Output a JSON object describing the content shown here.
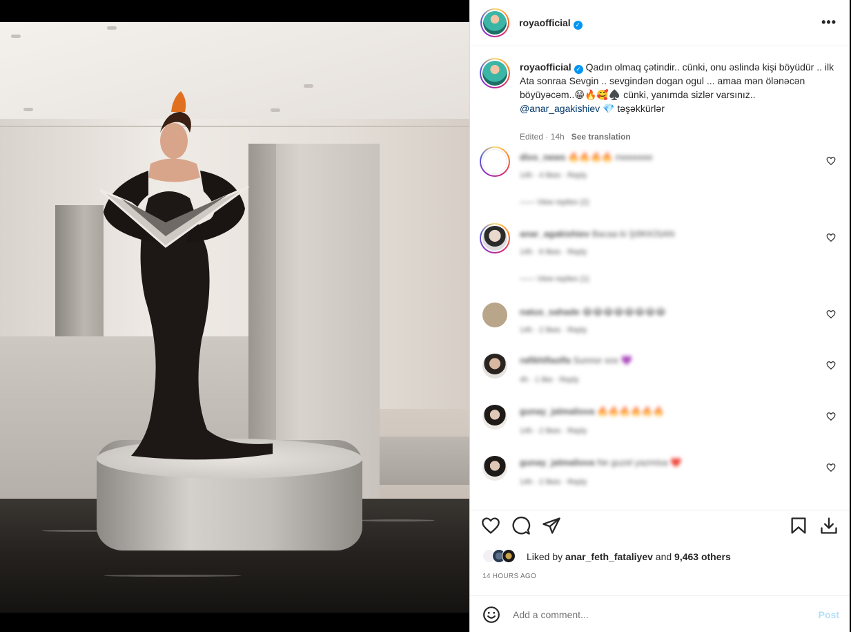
{
  "post": {
    "username": "royaofficial",
    "verified_mark": "✓",
    "more_icon": "•••",
    "caption": {
      "username": "royaofficial",
      "text_part1": "Qadın olmaq çətindir.. cünki, onu əslində kişi böyüdür .. ilk Ata sonraa Sevgin .. sevgindən dogan ogul ... amaa mən ölənəcən böyüyəcəm..😁🔥🥰♠️ cünki, yanımda sizlər varsınız.. ",
      "mention": "@anar_agakishiev",
      "text_part2": " 💎 təşəkkürlər",
      "edited": "Edited · 14h",
      "see_translation": "See translation"
    },
    "comments": [
      {
        "username": "divo_news",
        "text": "🔥🔥🔥🔥 meeeeee",
        "meta": "14h · 4 likes · Reply",
        "replies": "View replies (2)",
        "avatar_color": "#ffffff"
      },
      {
        "username": "anar_agakishiev",
        "text": "Bacaa ki ŞƏKKİSAN",
        "meta": "14h · 6 likes · Reply",
        "replies": "View replies (1)",
        "avatar_color": "#d9d9d9"
      },
      {
        "username": "natus_sahade",
        "text": "😂😂😂😂😂😂😂😂",
        "meta": "14h · 2 likes · Reply",
        "replies": "",
        "avatar_color": "#b9a68a"
      },
      {
        "username": "rafikhlfaolfa",
        "text": "Sunnor xox 💜",
        "meta": "4h · 1 like · Reply",
        "replies": "",
        "avatar_color": "#8a7b70"
      },
      {
        "username": "gunay_jalmaliova",
        "text": "🔥🔥🔥🔥🔥🔥",
        "meta": "14h · 2 likes · Reply",
        "replies": "",
        "avatar_color": "#c2b5ad"
      },
      {
        "username": "gunay_jalmaliova",
        "text": "Ne guzel yazmisa ❤️",
        "meta": "14h · 2 likes · Reply",
        "replies": "",
        "avatar_color": "#a99990"
      }
    ],
    "liked_by_prefix": "Liked by ",
    "liked_by_user": "anar_feth_fataliyev",
    "liked_by_mid": " and ",
    "liked_by_count": "9,463 others",
    "timestamp": "14 HOURS AGO",
    "comment_placeholder": "Add a comment...",
    "post_label": "Post"
  },
  "colors": {
    "link": "#00376b",
    "verified": "#0095f6",
    "post_disabled": "#b2dffc",
    "muted": "#737373"
  },
  "icons": [
    "more-icon",
    "heart-icon",
    "comment-icon",
    "share-icon",
    "bookmark-icon",
    "download-icon",
    "emoji-icon",
    "verified-icon"
  ]
}
